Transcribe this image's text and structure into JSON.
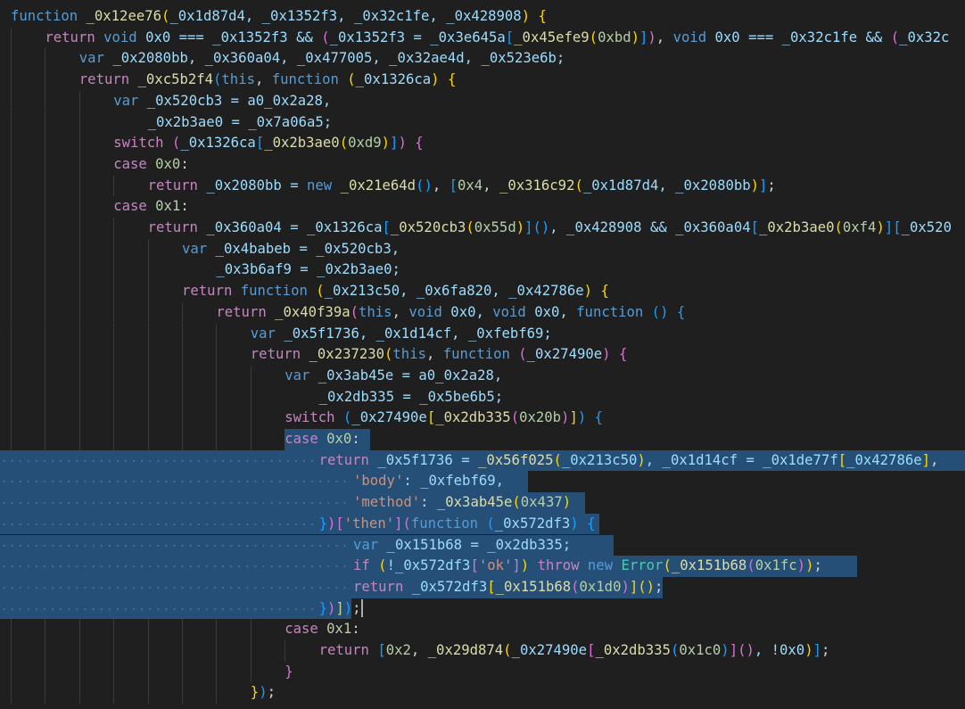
{
  "editor": {
    "language": "javascript",
    "selection_color": "#264f78",
    "lines": [
      [
        "function",
        " ",
        "_0x12ee76",
        "(",
        "_0x1d87d4, _0x1352f3, _0x32c1fe, _0x428908",
        ")",
        " ",
        "{"
      ],
      [
        "return",
        " ",
        "void",
        " 0x0 === _0x1352f3 && ",
        "(",
        "_0x1352f3 = _0x3e645a",
        "[",
        "_0x45efe9",
        "(",
        "0xbd",
        ")",
        "]",
        ")",
        ", ",
        "void",
        " 0x0 === _0x32c1fe && ",
        "(",
        "_0x32c"
      ],
      [
        "var",
        " _0x2080bb, _0x360a04, _0x477005, _0x32ae4d, _0x523e6b;"
      ],
      [
        "return",
        " ",
        "_0xc5b2f4",
        "(",
        "this",
        ", ",
        "function",
        " ",
        "(",
        "_0x1326ca",
        ")",
        " ",
        "{"
      ],
      [
        "var",
        " _0x520cb3 = a0_0x2a28,"
      ],
      [
        "_0x2b3ae0 = _0x7a06a5;"
      ],
      [
        "switch",
        " ",
        "(",
        "_0x1326ca",
        "[",
        "_0x2b3ae0",
        "(",
        "0xd9",
        ")",
        "]",
        ")",
        " ",
        "{"
      ],
      [
        "case",
        " ",
        "0x0",
        ":"
      ],
      [
        "return",
        " _0x2080bb = ",
        "new",
        " ",
        "_0x21e64d",
        "(",
        ")",
        ", ",
        "[",
        "0x4",
        ", ",
        "_0x316c92",
        "(",
        "_0x1d87d4, _0x2080bb",
        ")",
        "]",
        ";"
      ],
      [
        "case",
        " ",
        "0x1",
        ":"
      ],
      [
        "return",
        " _0x360a04 = _0x1326ca",
        "[",
        "_0x520cb3",
        "(",
        "0x55d",
        ")",
        "]",
        "(",
        ")",
        ", _0x428908 && _0x360a04",
        "[",
        "_0x2b3ae0",
        "(",
        "0xf4",
        ")",
        "]",
        "[",
        "_0x520"
      ],
      [
        "var",
        " _0x4babeb = _0x520cb3,"
      ],
      [
        "_0x3b6af9 = _0x2b3ae0;"
      ],
      [
        "return",
        " ",
        "function",
        " ",
        "(",
        "_0x213c50, _0x6fa820, _0x42786e",
        ")",
        " ",
        "{"
      ],
      [
        "return",
        " ",
        "_0x40f39a",
        "(",
        "this",
        ", ",
        "void",
        " 0x0, ",
        "void",
        " 0x0, ",
        "function",
        " ",
        "(",
        ")",
        " ",
        "{"
      ],
      [
        "var",
        " _0x5f1736, _0x1d14cf, _0xfebf69;"
      ],
      [
        "return",
        " ",
        "_0x237230",
        "(",
        "this",
        ", ",
        "function",
        " ",
        "(",
        "_0x27490e",
        ")",
        " ",
        "{"
      ],
      [
        "var",
        " _0x3ab45e = a0_0x2a28,"
      ],
      [
        "_0x2db335 = _0x5be6b5;"
      ],
      [
        "switch",
        " ",
        "(",
        "_0x27490e",
        "[",
        "_0x2db335",
        "(",
        "0x20b",
        ")",
        "]",
        ")",
        " ",
        "{"
      ],
      [
        "case",
        " ",
        "0x0",
        ":"
      ],
      [
        "return",
        " _0x5f1736 = ",
        "_0x56f025",
        "(",
        "_0x213c50",
        ")",
        ", _0x1d14cf = _0x1de77f",
        "[",
        "_0x42786e",
        "]",
        ", "
      ],
      [
        "'body'",
        ": _0xfebf69,"
      ],
      [
        "'method'",
        ": ",
        "_0x3ab45e",
        "(",
        "0x437",
        ")"
      ],
      [
        "}",
        ")",
        "[",
        "'then'",
        "]",
        "(",
        "function",
        " ",
        "(",
        "_0x572df3",
        ")",
        " ",
        "{"
      ],
      [
        "var",
        " _0x151b68 = _0x2db335;"
      ],
      [
        "if",
        " ",
        "(",
        "!_0x572df3",
        "[",
        "'ok'",
        "]",
        ")",
        " ",
        "throw",
        " ",
        "new",
        " ",
        "Error",
        "(",
        "_0x151b68",
        "(",
        "0x1fc",
        ")",
        ")",
        ";"
      ],
      [
        "return",
        " _0x572df3",
        "[",
        "_0x151b68",
        "(",
        "0x1d0",
        ")",
        "]",
        "(",
        ")",
        ";"
      ],
      [
        "}",
        ")",
        "]",
        ")",
        ";"
      ],
      [
        "case",
        " ",
        "0x1",
        ":"
      ],
      [
        "return",
        " ",
        "[",
        "0x2",
        ", ",
        "_0x29d874",
        "(",
        "_0x27490e",
        "[",
        "_0x2db335",
        "(",
        "0x1c0",
        ")",
        "]",
        "(",
        ")",
        ", !0x0",
        ")",
        "]",
        ";"
      ],
      [
        "}"
      ],
      [
        "}",
        ")",
        ";"
      ]
    ]
  }
}
